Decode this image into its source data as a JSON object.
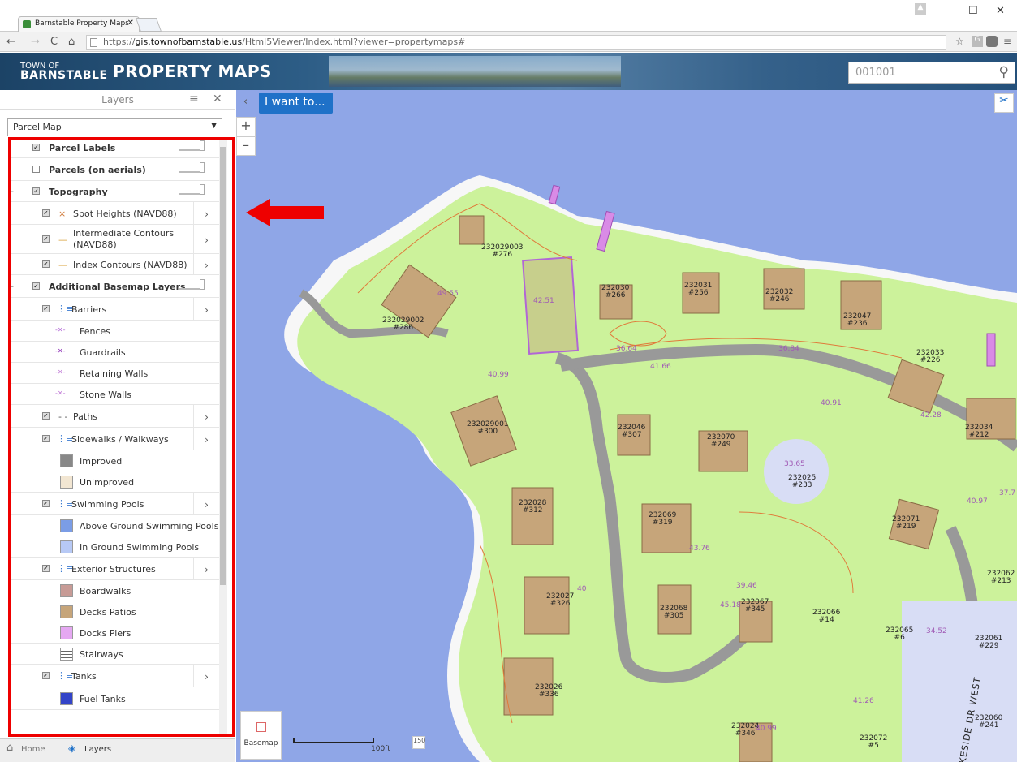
{
  "browser": {
    "tab_title": "Barnstable Property Maps",
    "url_prefix": "https://",
    "url_host": "gis.townofbarnstable.us",
    "url_path": "/Html5Viewer/Index.html?viewer=propertymaps#"
  },
  "header": {
    "town_line1": "TOWN OF",
    "town_line2": "BARNSTABLE",
    "title": "PROPERTY MAPS",
    "search_value": "001001"
  },
  "panel": {
    "title": "Layers",
    "basemap_select": "Parcel Map",
    "items": [
      {
        "label": "Parcel Labels",
        "checked": true,
        "toggle": true,
        "bold": true
      },
      {
        "label": "Parcels (on aerials)",
        "checked": false,
        "toggle": true,
        "bold": true
      },
      {
        "label": "Topography",
        "checked": true,
        "toggle": true,
        "bold": true,
        "collapse": true
      },
      {
        "label": "Spot Heights (NAVD88)",
        "checked": true,
        "chevron": true,
        "sym": "×"
      },
      {
        "label": "Intermediate Contours",
        "label2": "(NAVD88)",
        "checked": true,
        "chevron": true,
        "sym": "—"
      },
      {
        "label": "Index Contours (NAVD88)",
        "checked": true,
        "chevron": true,
        "sym": "—"
      },
      {
        "label": "Additional Basemap Layers",
        "checked": true,
        "toggle": true,
        "bold": true,
        "collapse": true
      },
      {
        "label": "Barriers",
        "checked": true,
        "chevron": true,
        "legend": true
      },
      {
        "label": "Fences",
        "sub": true
      },
      {
        "label": "Guardrails",
        "sub": true
      },
      {
        "label": "Retaining Walls",
        "sub": true
      },
      {
        "label": "Stone Walls",
        "sub": true
      },
      {
        "label": "Paths",
        "checked": true,
        "chevron": true,
        "sym": "- -"
      },
      {
        "label": "Sidewalks / Walkways",
        "checked": true,
        "chevron": true,
        "legend": true
      },
      {
        "label": "Improved",
        "sub": true
      },
      {
        "label": "Unimproved",
        "sub": true
      },
      {
        "label": "Swimming Pools",
        "checked": true,
        "chevron": true,
        "legend": true
      },
      {
        "label": "Above Ground Swimming Pools",
        "sub": true
      },
      {
        "label": "In Ground Swimming Pools",
        "sub": true
      },
      {
        "label": "Exterior Structures",
        "checked": true,
        "chevron": true,
        "legend": true
      },
      {
        "label": "Boardwalks",
        "sub": true
      },
      {
        "label": "Decks Patios",
        "sub": true
      },
      {
        "label": "Docks Piers",
        "sub": true
      },
      {
        "label": "Stairways",
        "sub": true
      },
      {
        "label": "Tanks",
        "checked": true,
        "chevron": true,
        "legend": true
      },
      {
        "label": "Fuel Tanks",
        "sub": true
      }
    ],
    "bottom_tabs": {
      "home": "Home",
      "layers": "Layers"
    }
  },
  "map": {
    "i_want_to": "I want to...",
    "basemap_label": "Basemap",
    "scale_label": "100ft",
    "parcels": [
      {
        "id": "232029003",
        "num": "#276"
      },
      {
        "id": "232029002",
        "num": "#286"
      },
      {
        "id": "232030",
        "num": "#266"
      },
      {
        "id": "232031",
        "num": "#256"
      },
      {
        "id": "232032",
        "num": "#246"
      },
      {
        "id": "232047",
        "num": "#236"
      },
      {
        "id": "232033",
        "num": "#226"
      },
      {
        "id": "232034",
        "num": "#212"
      },
      {
        "id": "232029001",
        "num": "#300"
      },
      {
        "id": "232046",
        "num": "#307"
      },
      {
        "id": "232070",
        "num": "#249"
      },
      {
        "id": "232025",
        "num": "#233"
      },
      {
        "id": "232028",
        "num": "#312"
      },
      {
        "id": "232069",
        "num": "#319"
      },
      {
        "id": "232071",
        "num": "#219"
      },
      {
        "id": "232062",
        "num": "#213"
      },
      {
        "id": "232027",
        "num": "#326"
      },
      {
        "id": "232068",
        "num": "#305"
      },
      {
        "id": "232067",
        "num": "#345"
      },
      {
        "id": "232066",
        "num": "#14"
      },
      {
        "id": "232065",
        "num": "#6"
      },
      {
        "id": "232061",
        "num": "#229"
      },
      {
        "id": "232026",
        "num": "#336"
      },
      {
        "id": "232024",
        "num": "#346"
      },
      {
        "id": "232072",
        "num": "#5"
      },
      {
        "id": "232060",
        "num": "#241"
      }
    ],
    "spot_heights": [
      "49.55",
      "42.51",
      "36.64",
      "36.84",
      "41.66",
      "40.99",
      "40.91",
      "42.28",
      "33.65",
      "40.97",
      "37.7",
      "43.76",
      "45.18",
      "39.46",
      "34.52",
      "41.26",
      "40.99",
      "40"
    ],
    "street_label": "KESIDE DR WEST"
  }
}
